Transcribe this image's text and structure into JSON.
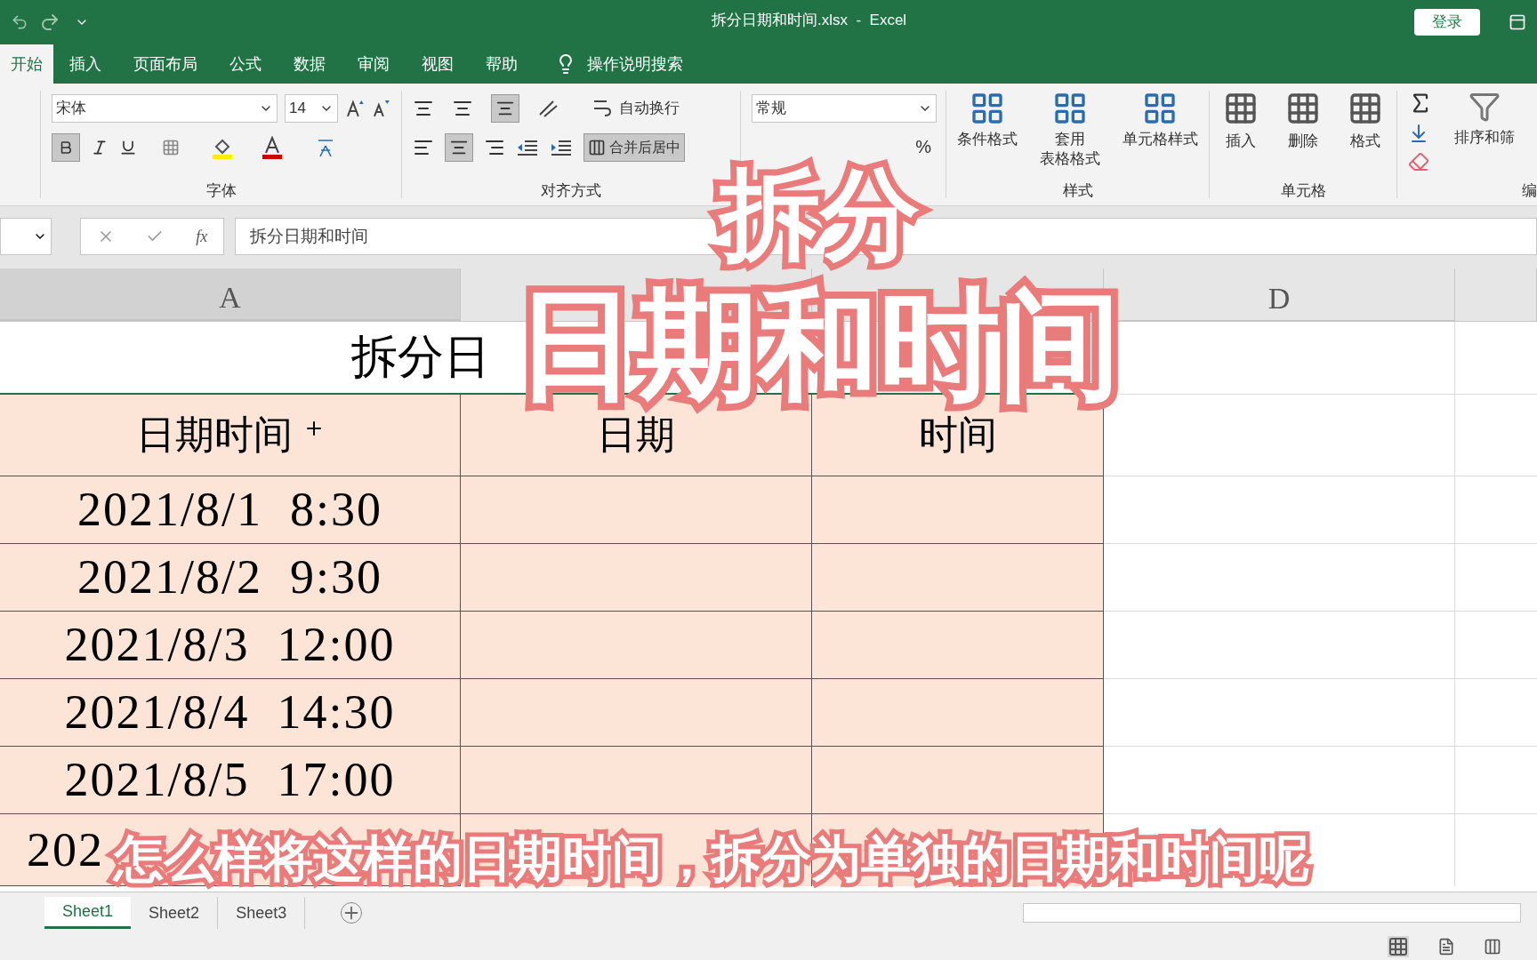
{
  "title_bar": {
    "title": "拆分日期和时间.xlsx  -  Excel",
    "login_button": "登录"
  },
  "tabs": [
    {
      "label": "开始",
      "selected": true
    },
    {
      "label": "插入",
      "selected": false
    },
    {
      "label": "页面布局",
      "selected": false
    },
    {
      "label": "公式",
      "selected": false
    },
    {
      "label": "数据",
      "selected": false
    },
    {
      "label": "审阅",
      "selected": false
    },
    {
      "label": "视图",
      "selected": false
    },
    {
      "label": "帮助",
      "selected": false
    }
  ],
  "tell_me": "操作说明搜索",
  "ribbon": {
    "font": {
      "font_name": "宋体",
      "font_size": "14",
      "label": "字体"
    },
    "alignment": {
      "wrap_text": "自动换行",
      "merge_center": "合并后居中",
      "label": "对齐方式"
    },
    "number": {
      "format": "常规",
      "percent": "%"
    },
    "styles": {
      "buttons": [
        {
          "line1": "条件格式"
        },
        {
          "line1": "套用",
          "line2": "表格格式"
        },
        {
          "line1": "单元格样式"
        }
      ],
      "label": "样式"
    },
    "cells": {
      "buttons": [
        "插入",
        "删除",
        "格式"
      ],
      "label": "单元格"
    },
    "editing": {
      "sort": "排序和筛",
      "label": "编"
    }
  },
  "formula_bar": {
    "function_label": "fx",
    "value": "拆分日期和时间"
  },
  "column_headers": {
    "a": "A",
    "d": "D"
  },
  "title_cell": "拆分日",
  "header_row": [
    "日期时间",
    "日期",
    "时间"
  ],
  "rows": [
    "2021/8/1  8:30",
    "2021/8/2  9:30",
    "2021/8/3  12:00",
    "2021/8/4  14:30",
    "2021/8/5  17:00",
    "202"
  ],
  "sheet_tabs": [
    {
      "label": "Sheet1",
      "selected": true
    },
    {
      "label": "Sheet2",
      "selected": false
    },
    {
      "label": "Sheet3",
      "selected": false
    }
  ],
  "overlay": {
    "line1": "拆分",
    "line2": "日期和时间",
    "subtitle": "怎么样将这样的日期时间，拆分为单独的日期和时间呢"
  }
}
